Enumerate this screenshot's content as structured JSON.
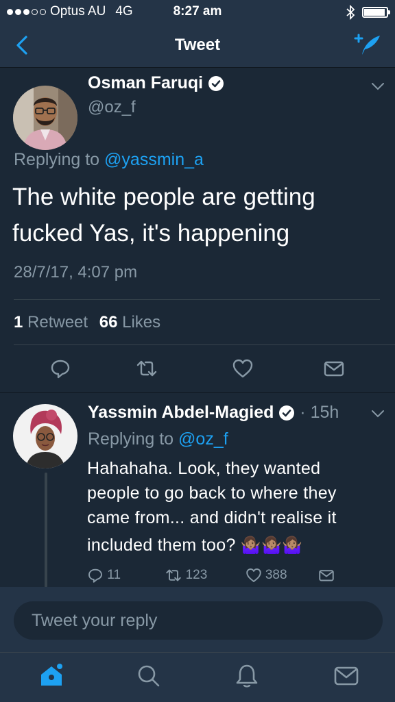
{
  "status_bar": {
    "carrier": "Optus AU",
    "network": "4G",
    "time": "8:27 am"
  },
  "nav": {
    "title": "Tweet"
  },
  "main_tweet": {
    "author_name": "Osman Faruqi",
    "author_handle": "@oz_f",
    "replying_prefix": "Replying to",
    "replying_to": "@yassmin_a",
    "text_line1": "The white people are getting",
    "text_line2": "fucked Yas, it's happening",
    "timestamp": "28/7/17, 4:07 pm",
    "retweet_count": "1",
    "retweet_label": "Retweet",
    "like_count": "66",
    "like_label": "Likes"
  },
  "reply_tweet": {
    "author_name": "Yassmin Abdel-Magied",
    "time_separator": "·",
    "age": "15h",
    "replying_prefix": "Replying to",
    "replying_to": "@oz_f",
    "text_line1": "Hahahaha. Look, they wanted",
    "text_line2": "people to go back to where they",
    "text_line3": "came from... and didn't realise it",
    "text_line4": "included them too?",
    "emoji": "🤷🏽‍♀️🤷🏽‍♀️🤷🏽‍♀️",
    "reply_count": "11",
    "retweet_count": "123",
    "like_count": "388"
  },
  "reply_box": {
    "placeholder": "Tweet your reply"
  },
  "colors": {
    "background": "#1b2836",
    "bar": "#243447",
    "accent": "#1da1f2",
    "muted": "#8899a6"
  },
  "icons": [
    "back-chevron-icon",
    "compose-icon",
    "verified-icon",
    "chevron-down-icon",
    "reply-icon",
    "retweet-icon",
    "heart-icon",
    "mail-icon",
    "home-icon",
    "search-icon",
    "bell-icon",
    "bluetooth-icon"
  ]
}
